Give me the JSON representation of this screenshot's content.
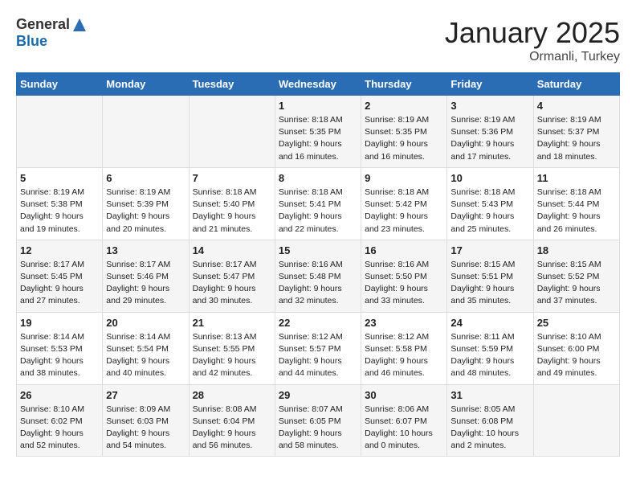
{
  "header": {
    "logo_general": "General",
    "logo_blue": "Blue",
    "month": "January 2025",
    "location": "Ormanli, Turkey"
  },
  "weekdays": [
    "Sunday",
    "Monday",
    "Tuesday",
    "Wednesday",
    "Thursday",
    "Friday",
    "Saturday"
  ],
  "weeks": [
    [
      {
        "day": "",
        "text": ""
      },
      {
        "day": "",
        "text": ""
      },
      {
        "day": "",
        "text": ""
      },
      {
        "day": "1",
        "text": "Sunrise: 8:18 AM\nSunset: 5:35 PM\nDaylight: 9 hours\nand 16 minutes."
      },
      {
        "day": "2",
        "text": "Sunrise: 8:19 AM\nSunset: 5:35 PM\nDaylight: 9 hours\nand 16 minutes."
      },
      {
        "day": "3",
        "text": "Sunrise: 8:19 AM\nSunset: 5:36 PM\nDaylight: 9 hours\nand 17 minutes."
      },
      {
        "day": "4",
        "text": "Sunrise: 8:19 AM\nSunset: 5:37 PM\nDaylight: 9 hours\nand 18 minutes."
      }
    ],
    [
      {
        "day": "5",
        "text": "Sunrise: 8:19 AM\nSunset: 5:38 PM\nDaylight: 9 hours\nand 19 minutes."
      },
      {
        "day": "6",
        "text": "Sunrise: 8:19 AM\nSunset: 5:39 PM\nDaylight: 9 hours\nand 20 minutes."
      },
      {
        "day": "7",
        "text": "Sunrise: 8:18 AM\nSunset: 5:40 PM\nDaylight: 9 hours\nand 21 minutes."
      },
      {
        "day": "8",
        "text": "Sunrise: 8:18 AM\nSunset: 5:41 PM\nDaylight: 9 hours\nand 22 minutes."
      },
      {
        "day": "9",
        "text": "Sunrise: 8:18 AM\nSunset: 5:42 PM\nDaylight: 9 hours\nand 23 minutes."
      },
      {
        "day": "10",
        "text": "Sunrise: 8:18 AM\nSunset: 5:43 PM\nDaylight: 9 hours\nand 25 minutes."
      },
      {
        "day": "11",
        "text": "Sunrise: 8:18 AM\nSunset: 5:44 PM\nDaylight: 9 hours\nand 26 minutes."
      }
    ],
    [
      {
        "day": "12",
        "text": "Sunrise: 8:17 AM\nSunset: 5:45 PM\nDaylight: 9 hours\nand 27 minutes."
      },
      {
        "day": "13",
        "text": "Sunrise: 8:17 AM\nSunset: 5:46 PM\nDaylight: 9 hours\nand 29 minutes."
      },
      {
        "day": "14",
        "text": "Sunrise: 8:17 AM\nSunset: 5:47 PM\nDaylight: 9 hours\nand 30 minutes."
      },
      {
        "day": "15",
        "text": "Sunrise: 8:16 AM\nSunset: 5:48 PM\nDaylight: 9 hours\nand 32 minutes."
      },
      {
        "day": "16",
        "text": "Sunrise: 8:16 AM\nSunset: 5:50 PM\nDaylight: 9 hours\nand 33 minutes."
      },
      {
        "day": "17",
        "text": "Sunrise: 8:15 AM\nSunset: 5:51 PM\nDaylight: 9 hours\nand 35 minutes."
      },
      {
        "day": "18",
        "text": "Sunrise: 8:15 AM\nSunset: 5:52 PM\nDaylight: 9 hours\nand 37 minutes."
      }
    ],
    [
      {
        "day": "19",
        "text": "Sunrise: 8:14 AM\nSunset: 5:53 PM\nDaylight: 9 hours\nand 38 minutes."
      },
      {
        "day": "20",
        "text": "Sunrise: 8:14 AM\nSunset: 5:54 PM\nDaylight: 9 hours\nand 40 minutes."
      },
      {
        "day": "21",
        "text": "Sunrise: 8:13 AM\nSunset: 5:55 PM\nDaylight: 9 hours\nand 42 minutes."
      },
      {
        "day": "22",
        "text": "Sunrise: 8:12 AM\nSunset: 5:57 PM\nDaylight: 9 hours\nand 44 minutes."
      },
      {
        "day": "23",
        "text": "Sunrise: 8:12 AM\nSunset: 5:58 PM\nDaylight: 9 hours\nand 46 minutes."
      },
      {
        "day": "24",
        "text": "Sunrise: 8:11 AM\nSunset: 5:59 PM\nDaylight: 9 hours\nand 48 minutes."
      },
      {
        "day": "25",
        "text": "Sunrise: 8:10 AM\nSunset: 6:00 PM\nDaylight: 9 hours\nand 49 minutes."
      }
    ],
    [
      {
        "day": "26",
        "text": "Sunrise: 8:10 AM\nSunset: 6:02 PM\nDaylight: 9 hours\nand 52 minutes."
      },
      {
        "day": "27",
        "text": "Sunrise: 8:09 AM\nSunset: 6:03 PM\nDaylight: 9 hours\nand 54 minutes."
      },
      {
        "day": "28",
        "text": "Sunrise: 8:08 AM\nSunset: 6:04 PM\nDaylight: 9 hours\nand 56 minutes."
      },
      {
        "day": "29",
        "text": "Sunrise: 8:07 AM\nSunset: 6:05 PM\nDaylight: 9 hours\nand 58 minutes."
      },
      {
        "day": "30",
        "text": "Sunrise: 8:06 AM\nSunset: 6:07 PM\nDaylight: 10 hours\nand 0 minutes."
      },
      {
        "day": "31",
        "text": "Sunrise: 8:05 AM\nSunset: 6:08 PM\nDaylight: 10 hours\nand 2 minutes."
      },
      {
        "day": "",
        "text": ""
      }
    ]
  ]
}
